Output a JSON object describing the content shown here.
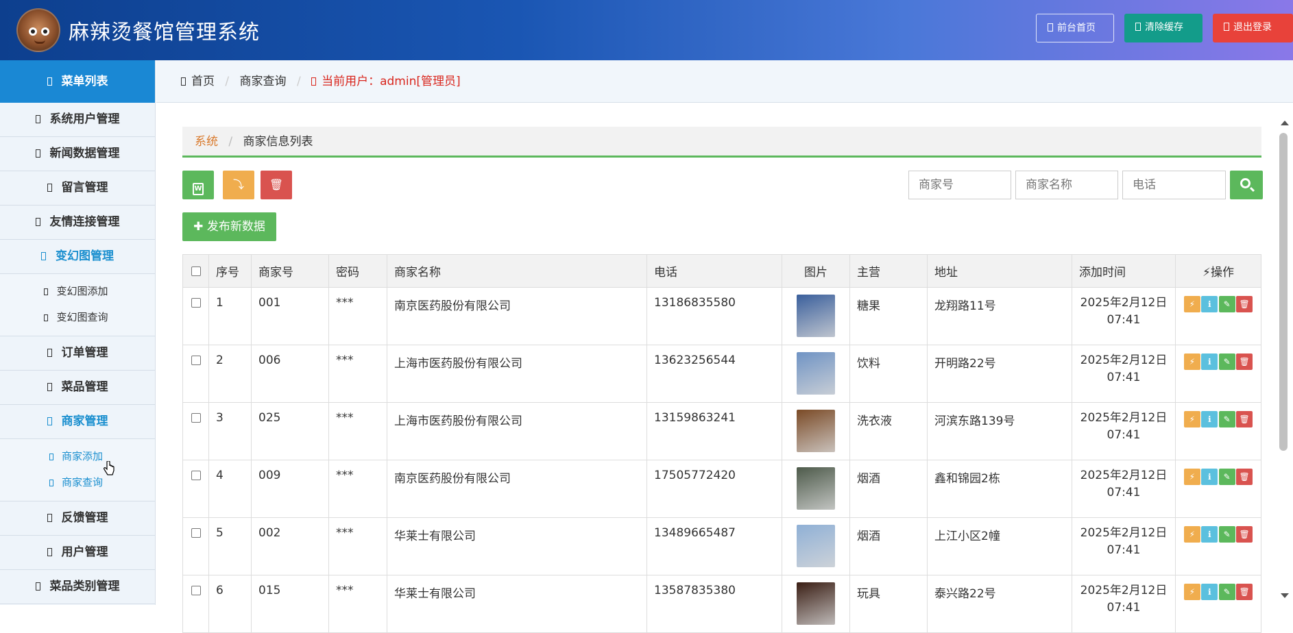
{
  "header": {
    "title": "麻辣烫餐馆管理系统",
    "btn_home": "前台首页",
    "btn_cache": "清除缓存",
    "btn_logout": "退出登录"
  },
  "sidebar": {
    "head": "菜单列表",
    "items_top": [
      "系统用户管理",
      "新闻数据管理",
      "留言管理",
      "友情连接管理"
    ],
    "carousel": {
      "label": "变幻图管理",
      "subs": [
        "变幻图添加",
        "变幻图查询"
      ]
    },
    "items_mid": [
      "订单管理",
      "菜品管理"
    ],
    "merchant": {
      "label": "商家管理",
      "subs": [
        "商家添加",
        "商家查询"
      ]
    },
    "items_bottom": [
      "反馈管理",
      "用户管理",
      "菜品类别管理"
    ]
  },
  "breadcrumb": {
    "home": "首页",
    "current": "商家查询",
    "user": "当前用户：admin[管理员]"
  },
  "panel": {
    "crumb_root": "系统",
    "crumb_title": "商家信息列表"
  },
  "search": {
    "merchant_no_placeholder": "商家号",
    "merchant_name_placeholder": "商家名称",
    "phone_placeholder": "电话"
  },
  "new_button": "发布新数据",
  "table": {
    "headers": [
      "序号",
      "商家号",
      "密码",
      "商家名称",
      "电话",
      "图片",
      "主营",
      "地址",
      "添加时间",
      "操作"
    ],
    "rows": [
      {
        "idx": "1",
        "no": "001",
        "pwd": "***",
        "name": "南京医药股份有限公司",
        "phone": "13186835580",
        "main": "糖果",
        "addr": "龙翔路11号",
        "date": "2025年2月12日",
        "time": "07:41",
        "img_color": "#3a5f9c"
      },
      {
        "idx": "2",
        "no": "006",
        "pwd": "***",
        "name": "上海市医药股份有限公司",
        "phone": "13623256544",
        "main": "饮料",
        "addr": "开明路22号",
        "date": "2025年2月12日",
        "time": "07:41",
        "img_color": "#6f93c4"
      },
      {
        "idx": "3",
        "no": "025",
        "pwd": "***",
        "name": "上海市医药股份有限公司",
        "phone": "13159863241",
        "main": "洗衣液",
        "addr": "河滨东路139号",
        "date": "2025年2月12日",
        "time": "07:41",
        "img_color": "#7a4a26"
      },
      {
        "idx": "4",
        "no": "009",
        "pwd": "***",
        "name": "南京医药股份有限公司",
        "phone": "17505772420",
        "main": "烟酒",
        "addr": "鑫和锦园2栋",
        "date": "2025年2月12日",
        "time": "07:41",
        "img_color": "#4d5a4a"
      },
      {
        "idx": "5",
        "no": "002",
        "pwd": "***",
        "name": "华莱士有限公司",
        "phone": "13489665487",
        "main": "烟酒",
        "addr": "上江小区2幢",
        "date": "2025年2月12日",
        "time": "07:41",
        "img_color": "#8fb0d6"
      },
      {
        "idx": "6",
        "no": "015",
        "pwd": "***",
        "name": "华莱士有限公司",
        "phone": "13587835380",
        "main": "玩具",
        "addr": "泰兴路22号",
        "date": "2025年2月12日",
        "time": "07:41",
        "img_color": "#3a1e14"
      }
    ]
  },
  "colors": {
    "header_start": "#0d3f8e",
    "header_end": "#8a78e8",
    "accent_blue": "#1a88d4",
    "green": "#5cb85c",
    "orange": "#f0ad4e",
    "red": "#d9534f"
  }
}
